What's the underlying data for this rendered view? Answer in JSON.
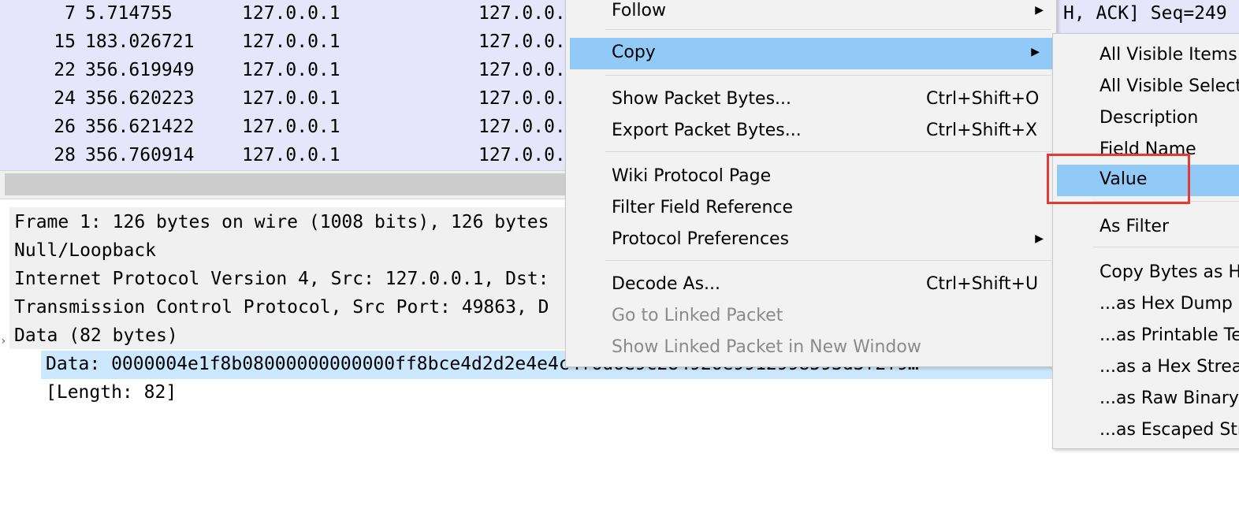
{
  "packet_list": {
    "rows": [
      {
        "no": "7",
        "time": "5.714755",
        "src": "127.0.0.1",
        "dst": "127.0.0."
      },
      {
        "no": "15",
        "time": "183.026721",
        "src": "127.0.0.1",
        "dst": "127.0.0."
      },
      {
        "no": "22",
        "time": "356.619949",
        "src": "127.0.0.1",
        "dst": "127.0.0."
      },
      {
        "no": "24",
        "time": "356.620223",
        "src": "127.0.0.1",
        "dst": "127.0.0."
      },
      {
        "no": "26",
        "time": "356.621422",
        "src": "127.0.0.1",
        "dst": "127.0.0."
      },
      {
        "no": "28",
        "time": "356.760914",
        "src": "127.0.0.1",
        "dst": "127.0.0."
      }
    ],
    "info_fragment": "H, ACK] Seq=249"
  },
  "details": {
    "tree": [
      "Frame 1: 126 bytes on wire (1008 bits), 126 bytes",
      "Null/Loopback",
      "Internet Protocol Version 4, Src: 127.0.0.1, Dst:",
      "Transmission Control Protocol, Src Port: 49863, D",
      "Data (82 bytes)"
    ],
    "data_row": "Data: 0000004e1f8b08000000000000ff8bce4d2d2e4e4c4f6d6e9c284926e9912998593d3f2f9…",
    "length_row": "[Length: 82]"
  },
  "context_menu": {
    "follow": "Follow",
    "copy": "Copy",
    "show_packet_bytes": "Show Packet Bytes...",
    "show_packet_bytes_shortcut": "Ctrl+Shift+O",
    "export_packet_bytes": "Export Packet Bytes...",
    "export_packet_bytes_shortcut": "Ctrl+Shift+X",
    "wiki_protocol_page": "Wiki Protocol Page",
    "filter_field_reference": "Filter Field Reference",
    "protocol_preferences": "Protocol Preferences",
    "decode_as": "Decode As...",
    "decode_as_shortcut": "Ctrl+Shift+U",
    "go_to_linked_packet": "Go to Linked Packet",
    "show_linked_packet": "Show Linked Packet in New Window"
  },
  "copy_submenu": {
    "all_visible_items": "All Visible Items",
    "all_visible_selected": "All Visible Selecte",
    "description": "Description",
    "field_name": "Field Name",
    "value": "Value",
    "as_filter": "As Filter",
    "copy_bytes_as_hex": "Copy Bytes as He",
    "as_hex_dump": "...as Hex Dump",
    "as_printable_text": "...as Printable Tex",
    "as_hex_stream": "...as a Hex Strean",
    "as_raw_binary": "...as Raw Binary",
    "as_escaped_string": "...as Escaped Stri"
  },
  "colors": {
    "packet_row_bg": "#e6e6fa",
    "menu_highlight": "#91c9f7",
    "selected_field_bg": "#cce8ff",
    "annotation_box": "#e53935"
  }
}
